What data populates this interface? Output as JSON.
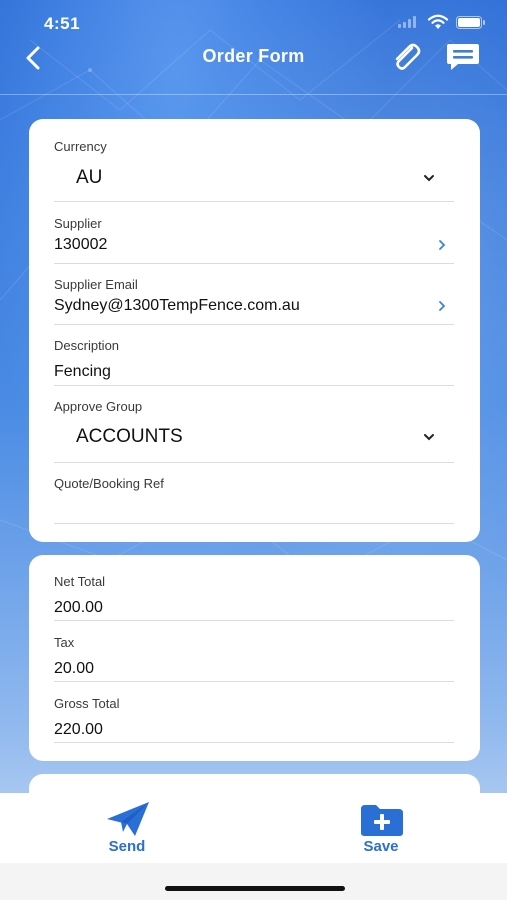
{
  "status_bar": {
    "time": "4:51"
  },
  "nav": {
    "title": "Order Form",
    "back_icon": "chevron-left-icon",
    "attach_icon": "paperclip-icon",
    "comment_icon": "chat-bubble-icon"
  },
  "form": {
    "currency": {
      "label": "Currency",
      "value": "AU"
    },
    "supplier": {
      "label": "Supplier",
      "value": "130002"
    },
    "supplier_email": {
      "label": "Supplier Email",
      "value": "Sydney@1300TempFence.com.au"
    },
    "description": {
      "label": "Description",
      "value": "Fencing"
    },
    "approve_group": {
      "label": "Approve Group",
      "value": "ACCOUNTS"
    },
    "quote_ref": {
      "label": "Quote/Booking Ref",
      "value": ""
    }
  },
  "totals": {
    "net_total": {
      "label": "Net Total",
      "value": "200.00"
    },
    "tax": {
      "label": "Tax",
      "value": "20.00"
    },
    "gross_total": {
      "label": "Gross Total",
      "value": "220.00"
    }
  },
  "bottom_bar": {
    "send_label": "Send",
    "save_label": "Save"
  },
  "colors": {
    "accent": "#2a6fd6",
    "chevron_blue": "#3b82e0",
    "background_top": "#2e6fd8"
  }
}
